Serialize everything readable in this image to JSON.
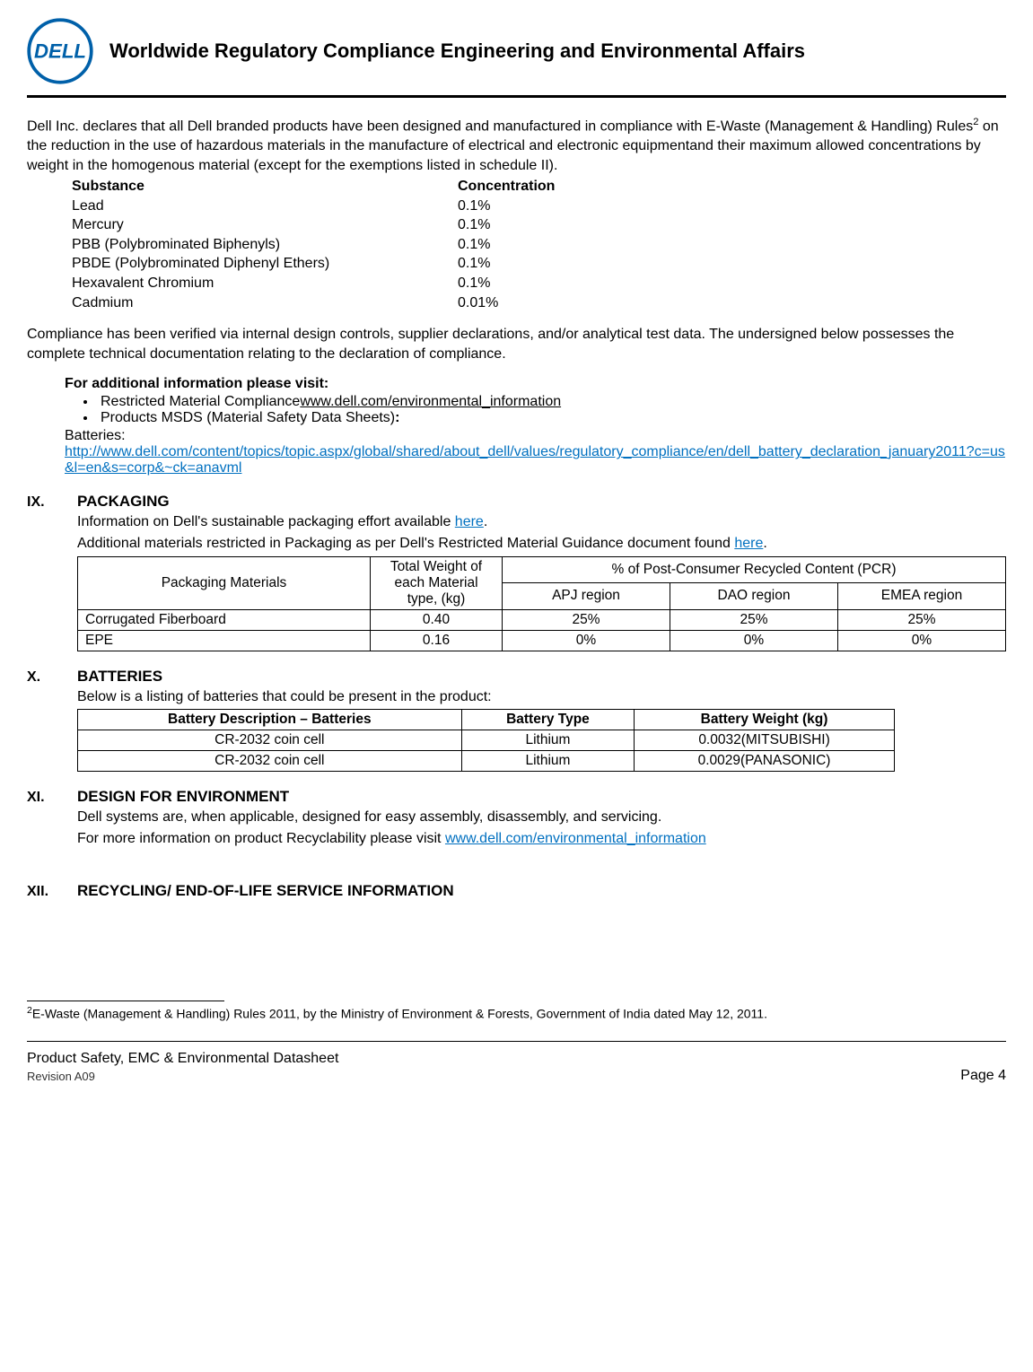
{
  "header": {
    "title": "Worldwide Regulatory Compliance Engineering and Environmental Affairs"
  },
  "intro": {
    "p1a": "Dell Inc. declares that all Dell branded products have been designed and manufactured in compliance with  E-Waste (Management & Handling) Rules",
    "p1sup": "2",
    "p1b": "  on the reduction in the use of hazardous materials in the manufacture of electrical and electronic equipmentand their  maximum allowed concentrations by weight  in the homogenous material (except for the exemptions listed in schedule II)."
  },
  "substances": {
    "headers": {
      "substance": "Substance",
      "concentration": "Concentration"
    },
    "rows": [
      {
        "substance": "Lead",
        "concentration": "0.1%"
      },
      {
        "substance": "Mercury",
        "concentration": "0.1%"
      },
      {
        "substance": "PBB (Polybrominated Biphenyls)",
        "concentration": "0.1%"
      },
      {
        "substance": "PBDE (Polybrominated Diphenyl Ethers)",
        "concentration": "0.1%"
      },
      {
        "substance": "Hexavalent Chromium",
        "concentration": "0.1%"
      },
      {
        "substance": "Cadmium",
        "concentration": "0.01%"
      }
    ]
  },
  "intro2": "Compliance has been verified via internal design controls, supplier declarations, and/or analytical test data. The undersigned below possesses the complete technical documentation relating to the declaration of compliance.",
  "addinfo": {
    "title": "For additional information please visit:",
    "bullet1_text": "Restricted Material Compliance",
    "bullet1_link": "www.dell.com/environmental_information",
    "bullet2_text": "Products MSDS (Material Safety Data Sheets)",
    "bullet2_colon": ":",
    "batteries_label": "Batteries:",
    "batteries_link": "http://www.dell.com/content/topics/topic.aspx/global/shared/about_dell/values/regulatory_compliance/en/dell_battery_declaration_january2011?c=us&l=en&s=corp&~ck=anavml"
  },
  "sections": {
    "ix": {
      "num": "IX.",
      "title": "PACKAGING",
      "line1a": "Information on Dell's sustainable packaging effort available ",
      "line1_here": "here",
      "line1b": ".",
      "line2a": "Additional materials restricted in Packaging as per Dell's Restricted Material Guidance document found ",
      "line2_here": "here",
      "line2b": "."
    },
    "x": {
      "num": "X.",
      "title": "BATTERIES",
      "line1": "Below is a listing of batteries that could be present in the product:"
    },
    "xi": {
      "num": "XI.",
      "title": "DESIGN FOR ENVIRONMENT",
      "line1": "Dell systems are, when applicable, designed for easy assembly, disassembly, and servicing.",
      "line2a": "For more information on product Recyclability please visit ",
      "line2_link": "www.dell.com/environmental_information"
    },
    "xii": {
      "num": "XII.",
      "title": "RECYCLING/ END-OF-LIFE SERVICE INFORMATION"
    }
  },
  "packaging_table": {
    "headers": {
      "materials": "Packaging Materials",
      "weight": "Total Weight of each Material type, (kg)",
      "pcr": "% of Post-Consumer Recycled Content (PCR)",
      "apj": "APJ region",
      "dao": "DAO region",
      "emea": "EMEA region"
    },
    "rows": [
      {
        "material": "Corrugated Fiberboard",
        "weight": "0.40",
        "apj": "25%",
        "dao": "25%",
        "emea": "25%"
      },
      {
        "material": "EPE",
        "weight": "0.16",
        "apj": "0%",
        "dao": "0%",
        "emea": "0%"
      }
    ]
  },
  "batteries_table": {
    "headers": {
      "desc": "Battery Description – Batteries",
      "type": "Battery Type",
      "weight": "Battery Weight (kg)"
    },
    "rows": [
      {
        "desc": "CR-2032 coin cell",
        "type": "Lithium",
        "weight": "0.0032(MITSUBISHI)"
      },
      {
        "desc": "CR-2032 coin cell",
        "type": "Lithium",
        "weight": "0.0029(PANASONIC)"
      }
    ]
  },
  "footnote": {
    "sup": "2",
    "text": "E-Waste (Management & Handling) Rules 2011, by the Ministry of Environment & Forests, Government of India dated May 12, 2011."
  },
  "footer": {
    "title": "Product Safety, EMC & Environmental Datasheet",
    "revision": "Revision A09",
    "page": "Page 4"
  }
}
